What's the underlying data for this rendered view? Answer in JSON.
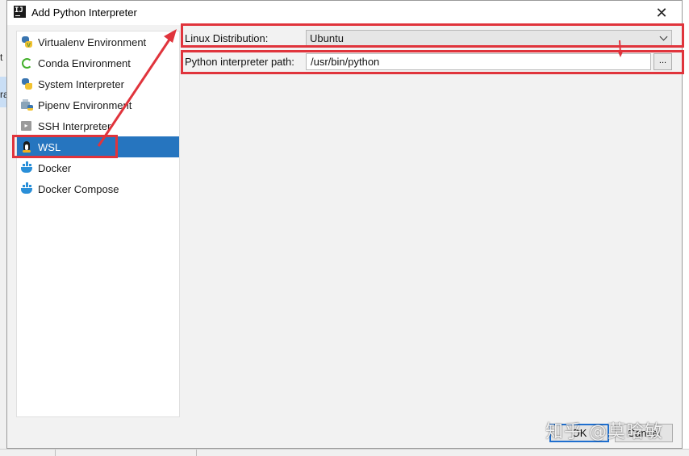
{
  "window": {
    "title": "Add Python Interpreter",
    "app_icon_text": "IJ",
    "close_glyph": "✕"
  },
  "background": {
    "edge_text_top": "t",
    "edge_text_mid": "ra"
  },
  "interpreter_types": [
    {
      "label": "Virtualenv Environment",
      "icon": "virtualenv-icon"
    },
    {
      "label": "Conda Environment",
      "icon": "conda-icon"
    },
    {
      "label": "System Interpreter",
      "icon": "python-icon"
    },
    {
      "label": "Pipenv Environment",
      "icon": "pipenv-icon"
    },
    {
      "label": "SSH Interpreter",
      "icon": "ssh-icon"
    },
    {
      "label": "WSL",
      "icon": "linux-tux-icon",
      "selected": true
    },
    {
      "label": "Docker",
      "icon": "docker-icon"
    },
    {
      "label": "Docker Compose",
      "icon": "docker-compose-icon"
    }
  ],
  "form": {
    "distribution_label": "Linux Distribution:",
    "distribution_value": "Ubuntu",
    "interpreter_path_label": "Python interpreter path:",
    "interpreter_path_value": "/usr/bin/python",
    "browse_label": "..."
  },
  "footer": {
    "ok_label": "OK",
    "cancel_label": "Cancel"
  },
  "watermark": "知乎 @莫晗敏",
  "colors": {
    "selection": "#2675bf",
    "annotation": "#e0343c",
    "default_button_border": "#1f6fcf"
  }
}
